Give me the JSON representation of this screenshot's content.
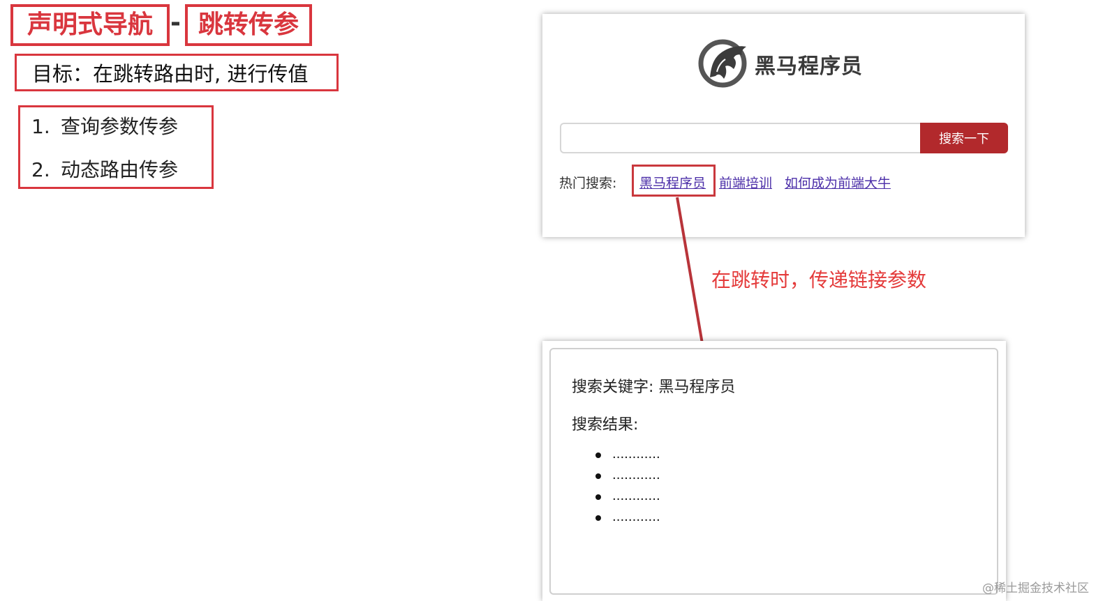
{
  "title": {
    "part1": "声明式导航",
    "separator": "-",
    "part2": "跳转传参"
  },
  "goal": "目标：在跳转路由时, 进行传值",
  "methods": [
    {
      "num": "1.",
      "label": "查询参数传参"
    },
    {
      "num": "2.",
      "label": "动态路由传参"
    }
  ],
  "search_page": {
    "logo_text": "黑马程序员",
    "logo_icon": "horse-head-logo-icon",
    "search_input_value": "",
    "search_button": "搜索一下",
    "hot_label": "热门搜索:",
    "hot_links": [
      "黑马程序员",
      "前端培训",
      "如何成为前端大牛"
    ],
    "button_color": "#b2292c",
    "link_color": "#4b2ea8"
  },
  "annotation": "在跳转时，传递链接参数",
  "result_page": {
    "keyword_label": "搜索关键字: 黑马程序员",
    "results_label": "搜索结果:",
    "results": [
      "............",
      "............",
      "............",
      "............"
    ]
  },
  "watermark": "@稀土掘金技术社区",
  "colors": {
    "accent_red": "#d9363e",
    "annotation_red": "#e43a3a"
  }
}
